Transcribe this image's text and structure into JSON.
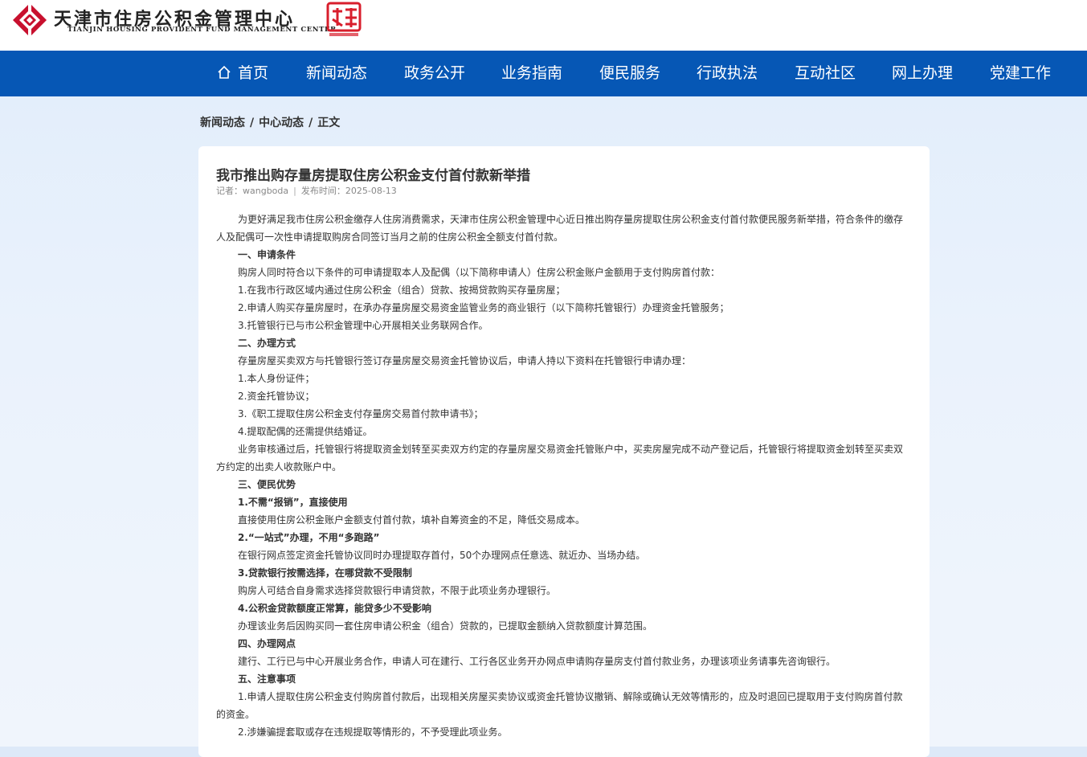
{
  "header": {
    "brand_cn": "天津市住房公积金管理中心",
    "brand_en": "TIANJIN  HOUSING  PROVIDENT  FUND  MANAGEMENT  CENTER",
    "seal_text": "天津 TIANJIN CHINA",
    "brand_color": "#c8102e"
  },
  "nav": {
    "color": "#0657b5",
    "items": [
      "首页",
      "新闻动态",
      "政务公开",
      "业务指南",
      "便民服务",
      "行政执法",
      "互动社区",
      "网上办理",
      "党建工作"
    ]
  },
  "breadcrumb": {
    "level1": "新闻动态",
    "level2": "中心动态",
    "level3": "正文",
    "sep": "/"
  },
  "article": {
    "title": "我市推出购存量房提取住房公积金支付首付款新举措",
    "author": "记者：wangboda",
    "date": "发布时间：2025-08-13",
    "paragraphs": [
      {
        "t": "为更好满足我市住房公积金缴存人住房消费需求，天津市住房公积金管理中心近日推出购存量房提取住房公积金支付首付款便民服务新举措，符合条件的缴存人及配偶可一次性申请提取购房合同签订当月之前的住房公积金全额支付首付款。",
        "h": false
      },
      {
        "t": "一、申请条件",
        "h": true
      },
      {
        "t": "购房人同时符合以下条件的可申请提取本人及配偶（以下简称申请人）住房公积金账户金额用于支付购房首付款：",
        "h": false
      },
      {
        "t": "1.在我市行政区域内通过住房公积金（组合）贷款、按揭贷款购买存量房屋；",
        "h": false
      },
      {
        "t": "2.申请人购买存量房屋时，在承办存量房屋交易资金监管业务的商业银行（以下简称托管银行）办理资金托管服务；",
        "h": false
      },
      {
        "t": "3.托管银行已与市公积金管理中心开展相关业务联网合作。",
        "h": false
      },
      {
        "t": "二、办理方式",
        "h": true
      },
      {
        "t": "存量房屋买卖双方与托管银行签订存量房屋交易资金托管协议后，申请人持以下资料在托管银行申请办理：",
        "h": false
      },
      {
        "t": "1.本人身份证件；",
        "h": false
      },
      {
        "t": "2.资金托管协议；",
        "h": false
      },
      {
        "t": "3.《职工提取住房公积金支付存量房交易首付款申请书》；",
        "h": false
      },
      {
        "t": "4.提取配偶的还需提供结婚证。",
        "h": false
      },
      {
        "t": "业务审核通过后，托管银行将提取资金划转至买卖双方约定的存量房屋交易资金托管账户中，买卖房屋完成不动产登记后，托管银行将提取资金划转至买卖双方约定的出卖人收款账户中。",
        "h": false
      },
      {
        "t": "三、便民优势",
        "h": true
      },
      {
        "t": "1.不需“报销”，直接使用",
        "h": true
      },
      {
        "t": "直接使用住房公积金账户金额支付首付款，填补自筹资金的不足，降低交易成本。",
        "h": false
      },
      {
        "t": "2.“一站式”办理，不用“多跑路”",
        "h": true
      },
      {
        "t": "在银行网点签定资金托管协议同时办理提取存首付，50个办理网点任意选、就近办、当场办结。",
        "h": false
      },
      {
        "t": "3.贷款银行按需选择，在哪贷款不受限制",
        "h": true
      },
      {
        "t": "购房人可结合自身需求选择贷款银行申请贷款，不限于此项业务办理银行。",
        "h": false
      },
      {
        "t": "4.公积金贷款额度正常算，能贷多少不受影响",
        "h": true
      },
      {
        "t": "办理该业务后因购买同一套住房申请公积金（组合）贷款的，已提取金额纳入贷款额度计算范围。",
        "h": false
      },
      {
        "t": "四、办理网点",
        "h": true
      },
      {
        "t": "建行、工行已与中心开展业务合作，申请人可在建行、工行各区业务开办网点申请购存量房支付首付款业务，办理该项业务请事先咨询银行。",
        "h": false
      },
      {
        "t": "五、注意事项",
        "h": true
      },
      {
        "t": "1.申请人提取住房公积金支付购房首付款后，出现相关房屋买卖协议或资金托管协议撤销、解除或确认无效等情形的，应及时退回已提取用于支付购房首付款的资金。",
        "h": false
      },
      {
        "t": "2.涉嫌骗提套取或存在违规提取等情形的，不予受理此项业务。",
        "h": false
      }
    ]
  }
}
